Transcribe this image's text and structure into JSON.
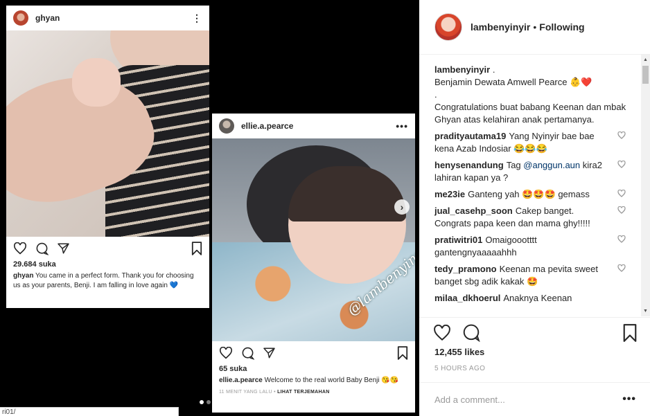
{
  "post1": {
    "username": "ghyan",
    "more": "⋮",
    "likes": "29.684 suka",
    "caption_user": "ghyan",
    "caption_text": " You came in a perfect form. Thank you for choosing us as your parents, Benji. I am falling in love again 💙"
  },
  "post2": {
    "username": "ellie.a.pearce",
    "more": "•••",
    "watermark": "@lambenyinyir",
    "next_arrow": "›",
    "likes": "65 suka",
    "caption_user": "ellie.a.pearce",
    "caption_text": " Welcome to the real world Baby Benji 😘😘",
    "time": "11 MENIT YANG LALU",
    "separator": " • ",
    "translate": "LIHAT TERJEMAHAN"
  },
  "statusbar": {
    "text": "ri01/"
  },
  "side": {
    "username": "lambenyinyir",
    "separator": "•",
    "follow_status": "Following",
    "caption": {
      "user": "lambenyinyir",
      "line1": " .",
      "line2": "Benjamin Dewata Amwell Pearce 👶❤️",
      "line3": ".",
      "line4": "Congratulations buat babang Keenan dan mbak Ghyan atas kelahiran anak pertamanya."
    },
    "comments": [
      {
        "user": "pradityautama19",
        "text": "Yang Nyinyir bae bae kena Azab Indosiar 😂😂😂"
      },
      {
        "user": "henysenandung",
        "text_before": "Tag ",
        "mention": "@anggun.aun",
        "text_after": " kira2 lahiran kapan ya ?"
      },
      {
        "user": "me23ie",
        "text": "Ganteng yah 🤩🤩🤩 gemass"
      },
      {
        "user": "jual_casehp_soon",
        "text": "Cakep banget. Congrats papa keen dan mama ghy!!!!!"
      },
      {
        "user": "pratiwitri01",
        "text": "Omaigoootttt gantengnyaaaaahhh"
      },
      {
        "user": "tedy_pramono",
        "text": "Keenan ma pevita sweet banget sbg adik kakak 🤩"
      },
      {
        "user": "milaa_dkhoerul",
        "text": "Anaknya Keenan"
      }
    ],
    "likes": "12,455 likes",
    "time": "5 HOURS AGO",
    "add_comment_placeholder": "Add a comment...",
    "more": "•••"
  },
  "colors": {
    "text": "#262626",
    "muted": "#999999",
    "mention": "#003569",
    "background": "#000000"
  }
}
